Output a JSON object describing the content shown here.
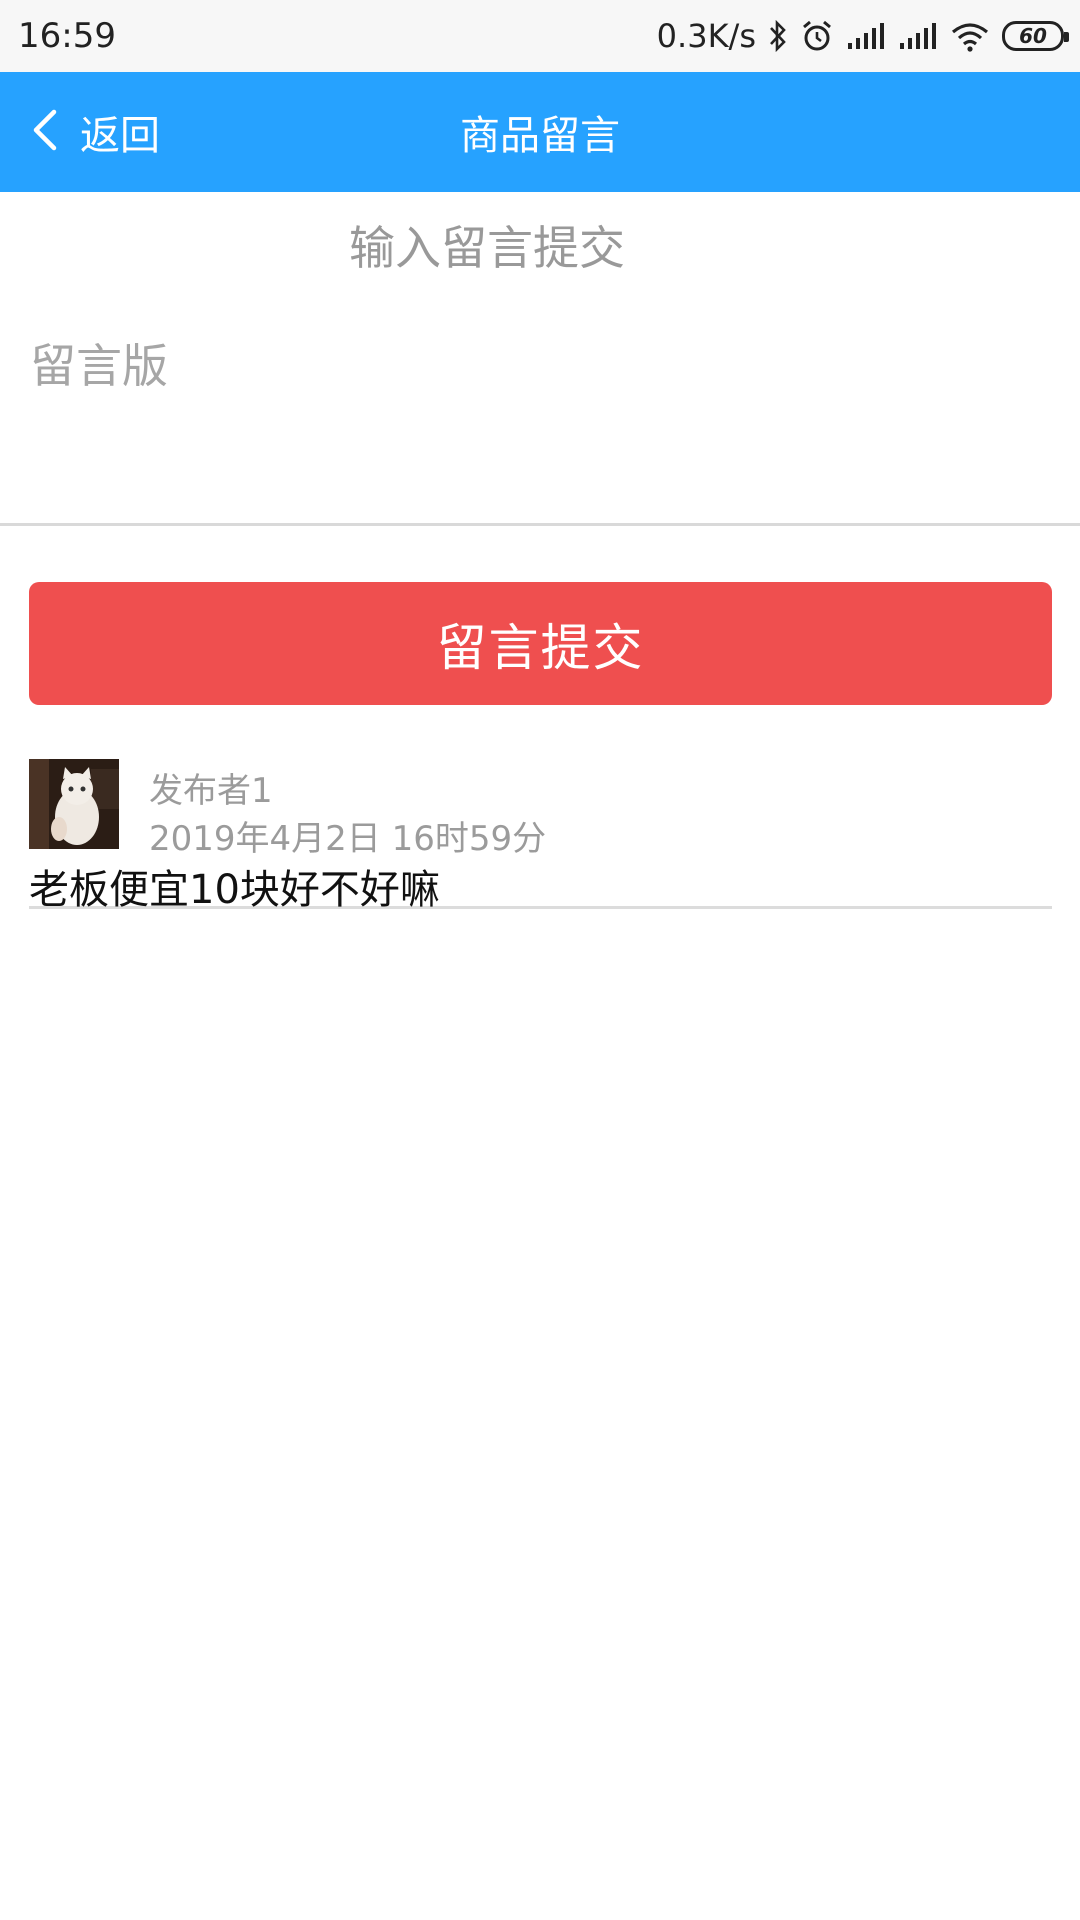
{
  "status_bar": {
    "time": "16:59",
    "net_speed": "0.3K/s",
    "battery": "60",
    "icons": [
      "bluetooth-icon",
      "alarm-icon",
      "signal-icon",
      "signal-icon",
      "wifi-icon",
      "battery-icon"
    ]
  },
  "header": {
    "back_label": "返回",
    "title": "商品留言",
    "background": "#26a2ff"
  },
  "form": {
    "section_title": "输入留言提交",
    "message_placeholder": "留言版",
    "message_value": "",
    "submit_label": "留言提交",
    "submit_color": "#ef4f4f"
  },
  "comments": [
    {
      "author": "发布者1",
      "time": "2019年4月2日 16时59分",
      "text": "老板便宜10块好不好嘛"
    }
  ]
}
